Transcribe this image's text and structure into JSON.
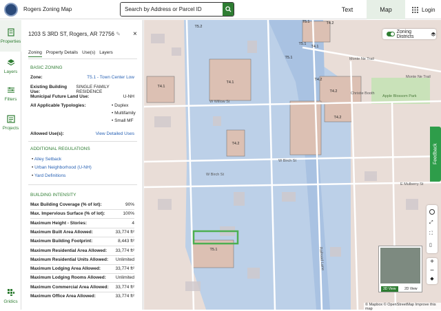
{
  "app": {
    "title": "Rogers Zoning Map"
  },
  "search": {
    "placeholder": "Search by Address or Parcel ID"
  },
  "header": {
    "tab_text": "Text",
    "tab_map": "Map",
    "login": "Login"
  },
  "nav": {
    "properties": "Properties",
    "layers": "Layers",
    "filters": "Filters",
    "projects": "Projects",
    "gridics": "Gridics"
  },
  "panel": {
    "address": "1203 S 3RD ST, Rogers, AR 72756",
    "tabs": [
      "Zoning",
      "Property Details",
      "Use(s)",
      "Layers"
    ],
    "basic": {
      "title": "BASIC ZONING",
      "zone_k": "Zone:",
      "zone_v": "T5.1 - Town Center Low",
      "use_k": "Existing Building Use:",
      "use_v": "SINGLE FAMILY RESIDENCE",
      "flu_k": "Municipal Future Land Use:",
      "flu_v": "U-NH",
      "typ_k": "All Applicable Typologies:",
      "typologies": [
        "Duplex",
        "Multifamily",
        "Small MF"
      ],
      "allowed_k": "Allowed Use(s):",
      "allowed_v": "View Detailed Uses"
    },
    "regs": {
      "title": "ADDITIONAL REGULATIONS",
      "items": [
        "Alley Setback",
        "Urban Neighborhood (U-NH)",
        "Yard Definitions"
      ]
    },
    "intensity": {
      "title": "BUILDING INTENSITY",
      "rows": [
        {
          "k": "Max Building Coverage (% of lot):",
          "v": "90%"
        },
        {
          "k": "Max. Impervious Surface (% of lot):",
          "v": "100%"
        },
        {
          "k": "Maximum Height - Stories:",
          "v": "4"
        },
        {
          "k": "Maximum Built Area Allowed:",
          "v": "33,774 ft²"
        },
        {
          "k": "Maximum Building Footprint:",
          "v": "8,443 ft²"
        },
        {
          "k": "Maximum Residential Area Allowed:",
          "v": "33,774 ft²"
        },
        {
          "k": "Maximum Residential Units Allowed:",
          "v": "Unlimited"
        },
        {
          "k": "Maximum Lodging Area Allowed:",
          "v": "33,774 ft²"
        },
        {
          "k": "Maximum Lodging Rooms Allowed:",
          "v": "Unlimited"
        },
        {
          "k": "Maximum Commercial Area Allowed:",
          "v": "33,774 ft²"
        },
        {
          "k": "Maximum Office Area Allowed:",
          "v": "33,774 ft²"
        }
      ]
    }
  },
  "map": {
    "zoning_toggle": "Zoning Districts",
    "feedback": "Feedback",
    "labels": [
      "T5.2",
      "T4.2",
      "T5.1",
      "T4.1",
      "T4.1",
      "T4.2",
      "T4.2",
      "T4.2",
      "T5.1",
      "T4.1",
      "T4.2",
      "T5.1",
      "T5.1"
    ],
    "streets": [
      "W Willow St",
      "W Birch St",
      "W Birch St",
      "E Mulberry St",
      "Monte Ne Trail",
      "Monte Ne Trail",
      "Railroad Lane",
      "Christie Booth",
      "Apple Blossom Park"
    ],
    "mini_3d": "3D View",
    "mini_2d": "2D View",
    "attribution": "© Mapbox © OpenStreetMap Improve this map",
    "colors": {
      "t5": "#b9cde6",
      "t4": "#e8d0c8",
      "parcel_highlight": "#4caf50",
      "park": "#c8e2b8"
    }
  }
}
